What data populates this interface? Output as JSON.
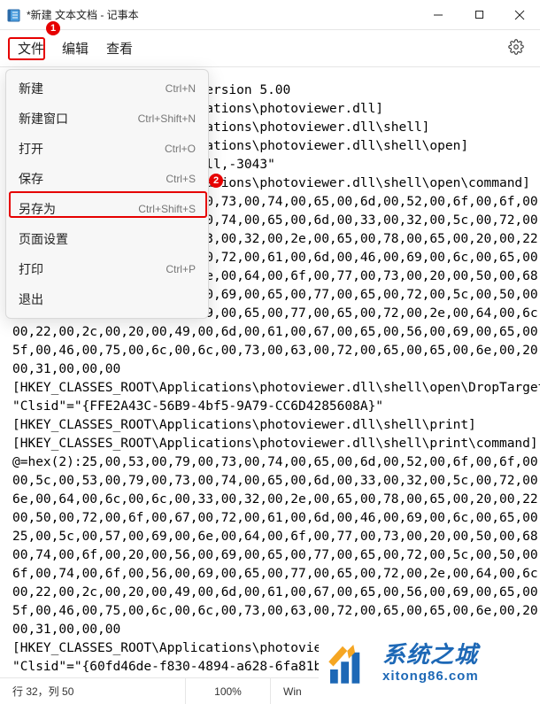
{
  "titlebar": {
    "title": "*新建 文本文档 - 记事本"
  },
  "menubar": {
    "items": [
      {
        "label": "文件"
      },
      {
        "label": "编辑"
      },
      {
        "label": "查看"
      }
    ]
  },
  "dropdown": {
    "items": [
      {
        "label": "新建",
        "shortcut": "Ctrl+N"
      },
      {
        "label": "新建窗口",
        "shortcut": "Ctrl+Shift+N"
      },
      {
        "label": "打开",
        "shortcut": "Ctrl+O"
      },
      {
        "label": "保存",
        "shortcut": "Ctrl+S"
      },
      {
        "label": "另存为",
        "shortcut": "Ctrl+Shift+S"
      },
      {
        "label": "页面设置",
        "shortcut": ""
      },
      {
        "label": "打印",
        "shortcut": "Ctrl+P"
      },
      {
        "label": "退出",
        "shortcut": ""
      }
    ]
  },
  "annotations": {
    "badge1": "1",
    "badge2": "2"
  },
  "doc_visible": "Windows Registry Editor Version 5.00\n[HKEY_CLASSES_ROOT\\Applications\\photoviewer.dll]\n[HKEY_CLASSES_ROOT\\Applications\\photoviewer.dll\\shell]\n[HKEY_CLASSES_ROOT\\Applications\\photoviewer.dll\\shell\\open]\n\"MuiVerb\"=\"@photoviewer.dll,-3043\"\n[HKEY_CLASSES_ROOT\\Applications\\photoviewer.dll\\shell\\open\\command]\n@=hex(2):25,00,53,00,79,00,73,00,74,00,65,00,6d,00,52,00,6f,00,6f,00,74,00,25,\\\n00,5c,00,53,00,79,00,73,00,74,00,65,00,6d,00,33,00,32,00,5c,00,72,00,75,00,\\\n6e,00,64,00,6c,00,6c,00,33,00,32,00,2e,00,65,00,78,00,65,00,20,00,22,00,25,\\\n00,50,00,72,00,6f,00,67,00,72,00,61,00,6d,00,46,00,69,00,6c,00,65,00,73,00,\\\n25,00,5c,00,57,00,69,00,6e,00,64,00,6f,00,77,00,73,00,20,00,50,00,68,00,6f,\\\n00,74,00,6f,00,20,00,56,00,69,00,65,00,77,00,65,00,72,00,5c,00,50,00,68,00,\\\n6f,00,74,00,6f,00,56,00,69,00,65,00,77,00,65,00,72,00,2e,00,64,00,6c,00,6c,\\\n00,22,00,2c,00,20,00,49,00,6d,00,61,00,67,00,65,00,56,00,69,00,65,00,77,00,\\\n5f,00,46,00,75,00,6c,00,6c,00,73,00,63,00,72,00,65,00,65,00,6e,00,20,00,25,\\\n00,31,00,00,00\n[HKEY_CLASSES_ROOT\\Applications\\photoviewer.dll\\shell\\open\\DropTarget]\n\"Clsid\"=\"{FFE2A43C-56B9-4bf5-9A79-CC6D4285608A}\"\n[HKEY_CLASSES_ROOT\\Applications\\photoviewer.dll\\shell\\print]\n[HKEY_CLASSES_ROOT\\Applications\\photoviewer.dll\\shell\\print\\command]\n@=hex(2):25,00,53,00,79,00,73,00,74,00,65,00,6d,00,52,00,6f,00,6f,00,74,00,25,\\\n00,5c,00,53,00,79,00,73,00,74,00,65,00,6d,00,33,00,32,00,5c,00,72,00,75,00,\\\n6e,00,64,00,6c,00,6c,00,33,00,32,00,2e,00,65,00,78,00,65,00,20,00,22,00,25,\\\n00,50,00,72,00,6f,00,67,00,72,00,61,00,6d,00,46,00,69,00,6c,00,65,00,73,00,\\\n25,00,5c,00,57,00,69,00,6e,00,64,00,6f,00,77,00,73,00,20,00,50,00,68,00,6f,\\\n00,74,00,6f,00,20,00,56,00,69,00,65,00,77,00,65,00,72,00,5c,00,50,00,68,00,\\\n6f,00,74,00,6f,00,56,00,69,00,65,00,77,00,65,00,72,00,2e,00,64,00,6c,00,6c,\\\n00,22,00,2c,00,20,00,49,00,6d,00,61,00,67,00,65,00,56,00,69,00,65,00,77,00,\\\n5f,00,46,00,75,00,6c,00,6c,00,73,00,63,00,72,00,65,00,65,00,6e,00,20,00,25,\\\n00,31,00,00,00\n[HKEY_CLASSES_ROOT\\Applications\\photoviewer.dll\\shell\\print\\DropTarget]\n\"Clsid\"=\"{60fd46de-f830-4894-a628-6fa81bc0190d}\"",
  "status": {
    "position": "行 32，列 50",
    "zoom": "100%",
    "eol": "Win"
  },
  "watermark": {
    "cn": "系统之城",
    "domain": "xitong86.com"
  }
}
